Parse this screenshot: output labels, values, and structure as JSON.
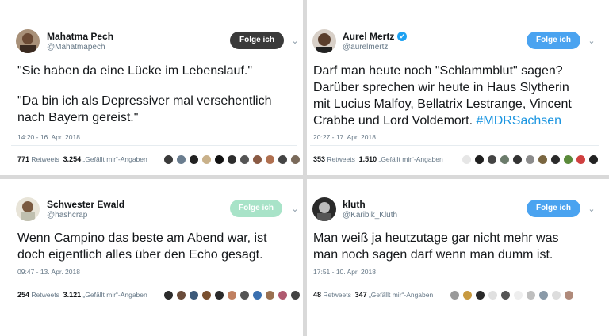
{
  "tweets": [
    {
      "name": "Mahatma Pech",
      "handle": "@Mahatmapech",
      "verified": false,
      "follow_label": "Folge ich",
      "text_lines": [
        "\"Sie haben da eine Lücke im Lebenslauf.\""
      ],
      "text_lines_2": [
        "\"Da bin ich als Depressiver mal versehentlich",
        "nach Bayern gereist.\""
      ],
      "datetime": "14:20 - 16. Apr. 2018",
      "retweets_count": "771",
      "retweets_label": "Retweets",
      "likes_count": "3.254",
      "likes_label": "„Gefällt mir“-Angaben",
      "face_colors": [
        "#3b3b3b",
        "#6a7d8f",
        "#222",
        "#c9b18a",
        "#111",
        "#2d2d2d",
        "#555",
        "#8a5a44",
        "#b07050",
        "#444",
        "#7a6a5a"
      ]
    },
    {
      "name": "Aurel Mertz",
      "handle": "@aurelmertz",
      "verified": true,
      "follow_label": "Folge ich",
      "text_lines": [
        "Darf man heute noch \"Schlammblut\" sagen?",
        "Darüber sprechen wir heute in Haus Slytherin",
        "mit Lucius Malfoy, Bellatrix Lestrange, Vincent"
      ],
      "text_last_prefix": "Crabbe und Lord Voldemort. ",
      "hashtag": "#MDRSachsen",
      "datetime": "20:27 - 17. Apr. 2018",
      "retweets_count": "353",
      "retweets_label": "Retweets",
      "likes_count": "1.510",
      "likes_label": "„Gefällt mir“-Angaben",
      "face_colors": [
        "#e6e6e6",
        "#1f1f1f",
        "#444",
        "#6b7b6b",
        "#333",
        "#8c8c8c",
        "#7a6640",
        "#2b2b2b",
        "#5a8a3a",
        "#d04040",
        "#222"
      ]
    },
    {
      "name": "Schwester Ewald",
      "handle": "@hashcrap",
      "verified": false,
      "follow_label": "Folge ich",
      "text_lines": [
        "Wenn Campino das beste am Abend war, ist",
        "doch eigentlich alles über den Echo gesagt."
      ],
      "datetime": "09:47 - 13. Apr. 2018",
      "retweets_count": "254",
      "retweets_label": "Retweets",
      "likes_count": "3.121",
      "likes_label": "„Gefällt mir“-Angaben",
      "face_colors": [
        "#2b2b2b",
        "#6a4c3a",
        "#3c5a7a",
        "#7a5030",
        "#2a2a2a",
        "#c08060",
        "#555",
        "#3a70b0",
        "#9a7050",
        "#b05a70",
        "#444"
      ]
    },
    {
      "name": "kluth",
      "handle": "@Karibik_Kluth",
      "verified": false,
      "follow_label": "Folge ich",
      "text_lines": [
        "Man weiß ja heutzutage gar nicht mehr was",
        "man noch sagen darf wenn man dumm ist."
      ],
      "datetime": "17:51 - 10. Apr. 2018",
      "retweets_count": "48",
      "retweets_label": "Retweets",
      "likes_count": "347",
      "likes_label": "„Gefällt mir“-Angaben",
      "face_colors": [
        "#9a9a9a",
        "#c89a40",
        "#2a2a2a",
        "#e0e0e0",
        "#555",
        "#eeeeee",
        "#bfbfbf",
        "#8a9aa8",
        "#dddddd",
        "#b08a7a"
      ]
    }
  ],
  "colors": {
    "follow_dark": "#3a3a3a",
    "follow_blue": "#4aa3f0",
    "follow_pale": "#a8e3c8",
    "hashtag": "#1b95e0",
    "divider": "#d9d9d9"
  }
}
